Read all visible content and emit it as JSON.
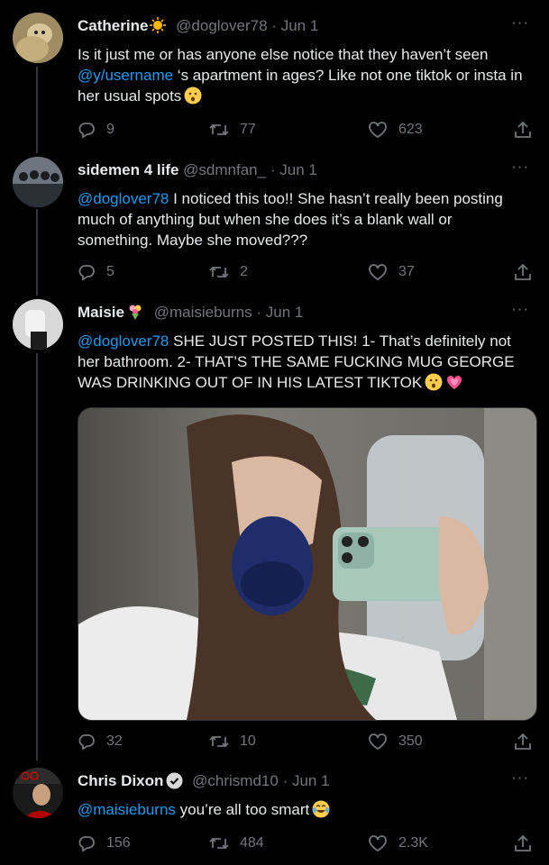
{
  "tweets": [
    {
      "name": "Catherine",
      "handle": "@doglover78",
      "date": "Jun 1",
      "text_1": "Is it just me or has anyone else notice that they haven’t seen ",
      "mention": "@y/username",
      "text_2": " ‘s apartment in ages? Like not one tiktok or insta in her usual spots",
      "emoji": "hushed-face",
      "replies": "9",
      "retweets": "77",
      "likes": "623"
    },
    {
      "name": "sidemen 4 life",
      "handle": "@sdmnfan_",
      "date": "Jun 1",
      "mention": "@doglover78",
      "text": " I noticed this too!! She hasn’t really been posting much of anything but when she does it’s a blank wall or something. Maybe she moved???",
      "replies": "5",
      "retweets": "2",
      "likes": "37"
    },
    {
      "name": "Maisie",
      "name_emoji": "bouquet",
      "handle": "@maisieburns",
      "date": "Jun 1",
      "mention": "@doglover78",
      "text": " SHE JUST POSTED THIS! 1- That’s definitely not her bathroom. 2- THAT’S THE SAME FUCKING MUG GEORGE WAS DRINKING OUT OF IN HIS LATEST TIKTOK",
      "emojis": [
        "hushed-face",
        "growing-heart"
      ],
      "media": "mirror selfie photo",
      "replies": "32",
      "retweets": "10",
      "likes": "350"
    },
    {
      "name": "Chris Dixon",
      "verified": true,
      "handle": "@chrismd10",
      "date": "Jun 1",
      "mention": "@maisieburns",
      "text": " you’re all too smart",
      "emoji": "tears-of-joy",
      "replies": "156",
      "retweets": "484",
      "likes": "2.3K"
    }
  ],
  "dot": "·",
  "more": "···",
  "colors": {
    "background": "#000000",
    "text": "#e7e9ea",
    "muted": "#71767b",
    "link": "#1d9bf0"
  }
}
